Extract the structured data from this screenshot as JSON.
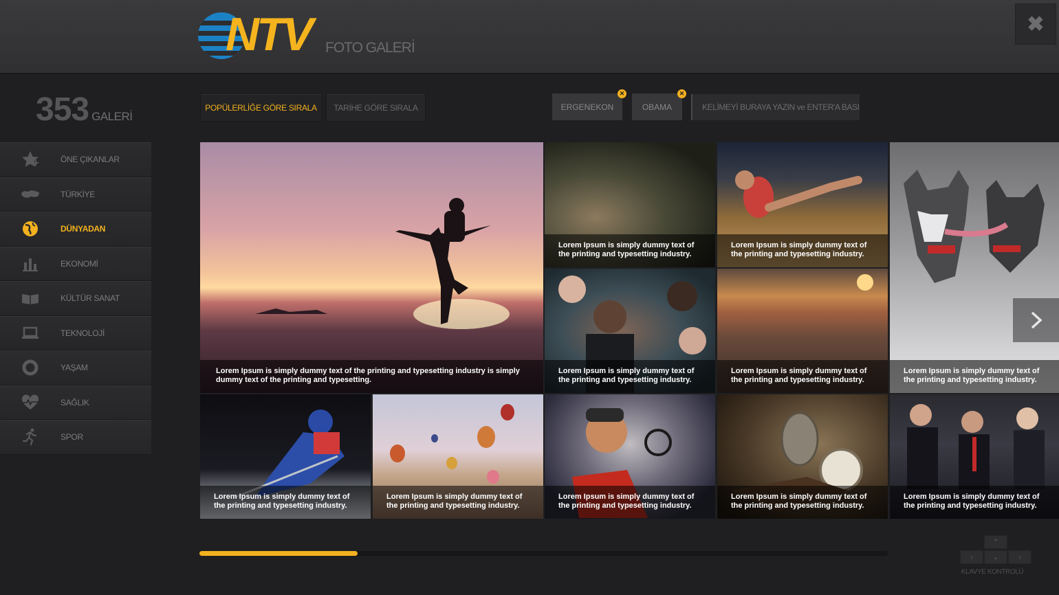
{
  "header": {
    "logo_text": "NTV",
    "logo_subtitle": "FOTO GALERİ",
    "close_symbol": "✖"
  },
  "counter": {
    "number": "353",
    "label": "GALERİ"
  },
  "sidebar": {
    "items": [
      {
        "label": "ÖNE ÇIKANLAR",
        "icon": "star-icon"
      },
      {
        "label": "TÜRKİYE",
        "icon": "turkey-map-icon"
      },
      {
        "label": "DÜNYADAN",
        "icon": "globe-icon"
      },
      {
        "label": "EKONOMİ",
        "icon": "bar-chart-icon"
      },
      {
        "label": "KÜLTÜR SANAT",
        "icon": "book-icon"
      },
      {
        "label": "TEKNOLOJİ",
        "icon": "laptop-icon"
      },
      {
        "label": "YAŞAM",
        "icon": "circle-icon"
      },
      {
        "label": "SAĞLIK",
        "icon": "heart-pulse-icon"
      },
      {
        "label": "SPOR",
        "icon": "runner-icon"
      }
    ],
    "active_index": 2
  },
  "sort": {
    "popular": "POPÜLERLİĞE GÖRE SIRALA",
    "date": "TARİHE GÖRE SIRALA"
  },
  "tags": [
    {
      "label": "ERGENEKON"
    },
    {
      "label": "OBAMA"
    }
  ],
  "search": {
    "placeholder": "KELİMEYİ BURAYA YAZIN ve ENTER'A BASIN"
  },
  "gallery": {
    "big_caption": "Lorem Ipsum is simply dummy text of the printing and typesetting industry is simply dummy text of the printing and typesetting.",
    "small_caption": "Lorem Ipsum is simply dummy text of the printing and typesetting industry.",
    "tall_caption": "Lorem Ipsum is simply dummy text of the printing and typesetting industry."
  },
  "progress": {
    "fraction": 0.23
  },
  "keyboard": {
    "label": "KLAVYE KONTROLÜ",
    "up": "⌃",
    "left": "‹",
    "down": "⌄",
    "right": "›"
  },
  "colors": {
    "accent": "#f3b11f",
    "logo_blue": "#1c82c6"
  }
}
